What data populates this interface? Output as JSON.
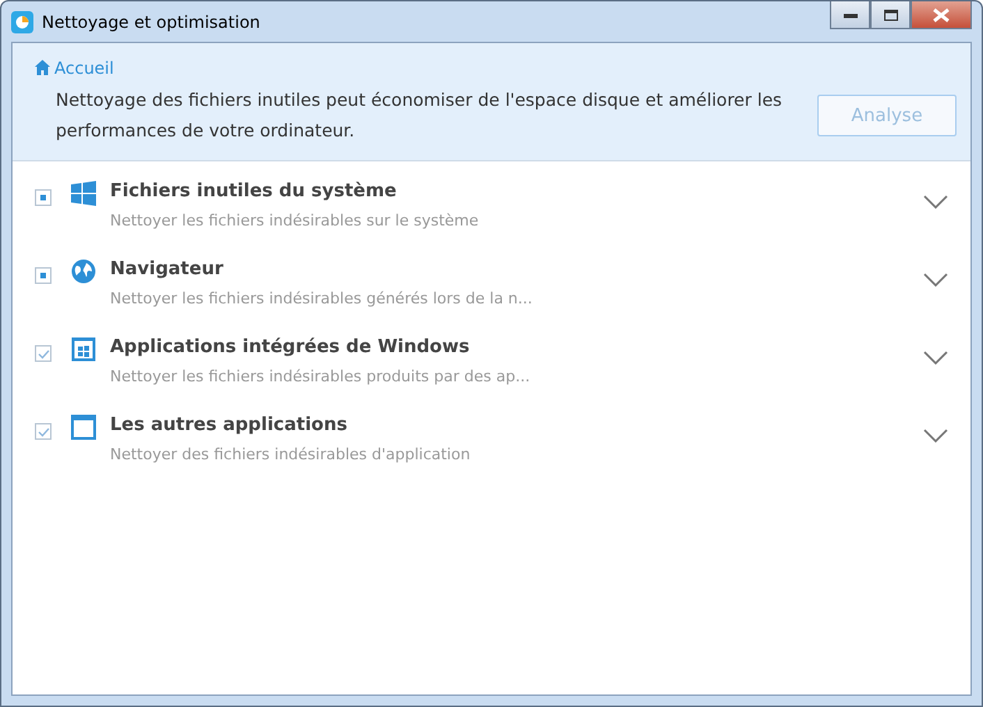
{
  "window": {
    "title": "Nettoyage et optimisation"
  },
  "header": {
    "breadcrumb": "Accueil",
    "description": "Nettoyage des fichiers inutiles peut économiser de l'espace disque et améliorer les performances de votre ordinateur.",
    "button": {
      "label": "Analyse",
      "disabled": true
    }
  },
  "items": [
    {
      "title": "Fichiers inutiles du système",
      "subtitle": "Nettoyer les fichiers indésirables sur le système",
      "checked": true,
      "indeterminate": true,
      "kind": "windows",
      "expanded": false
    },
    {
      "title": "Navigateur",
      "subtitle": "Nettoyer les fichiers indésirables générés lors de la n...",
      "checked": true,
      "indeterminate": true,
      "kind": "globe",
      "expanded": false
    },
    {
      "title": "Applications intégrées de Windows",
      "subtitle": "Nettoyer les fichiers indésirables produits par des ap...",
      "checked": true,
      "indeterminate": false,
      "kind": "apps",
      "expanded": false
    },
    {
      "title": "Les autres applications",
      "subtitle": "Nettoyer des fichiers indésirables d'application",
      "checked": true,
      "indeterminate": false,
      "kind": "window",
      "expanded": false
    }
  ]
}
